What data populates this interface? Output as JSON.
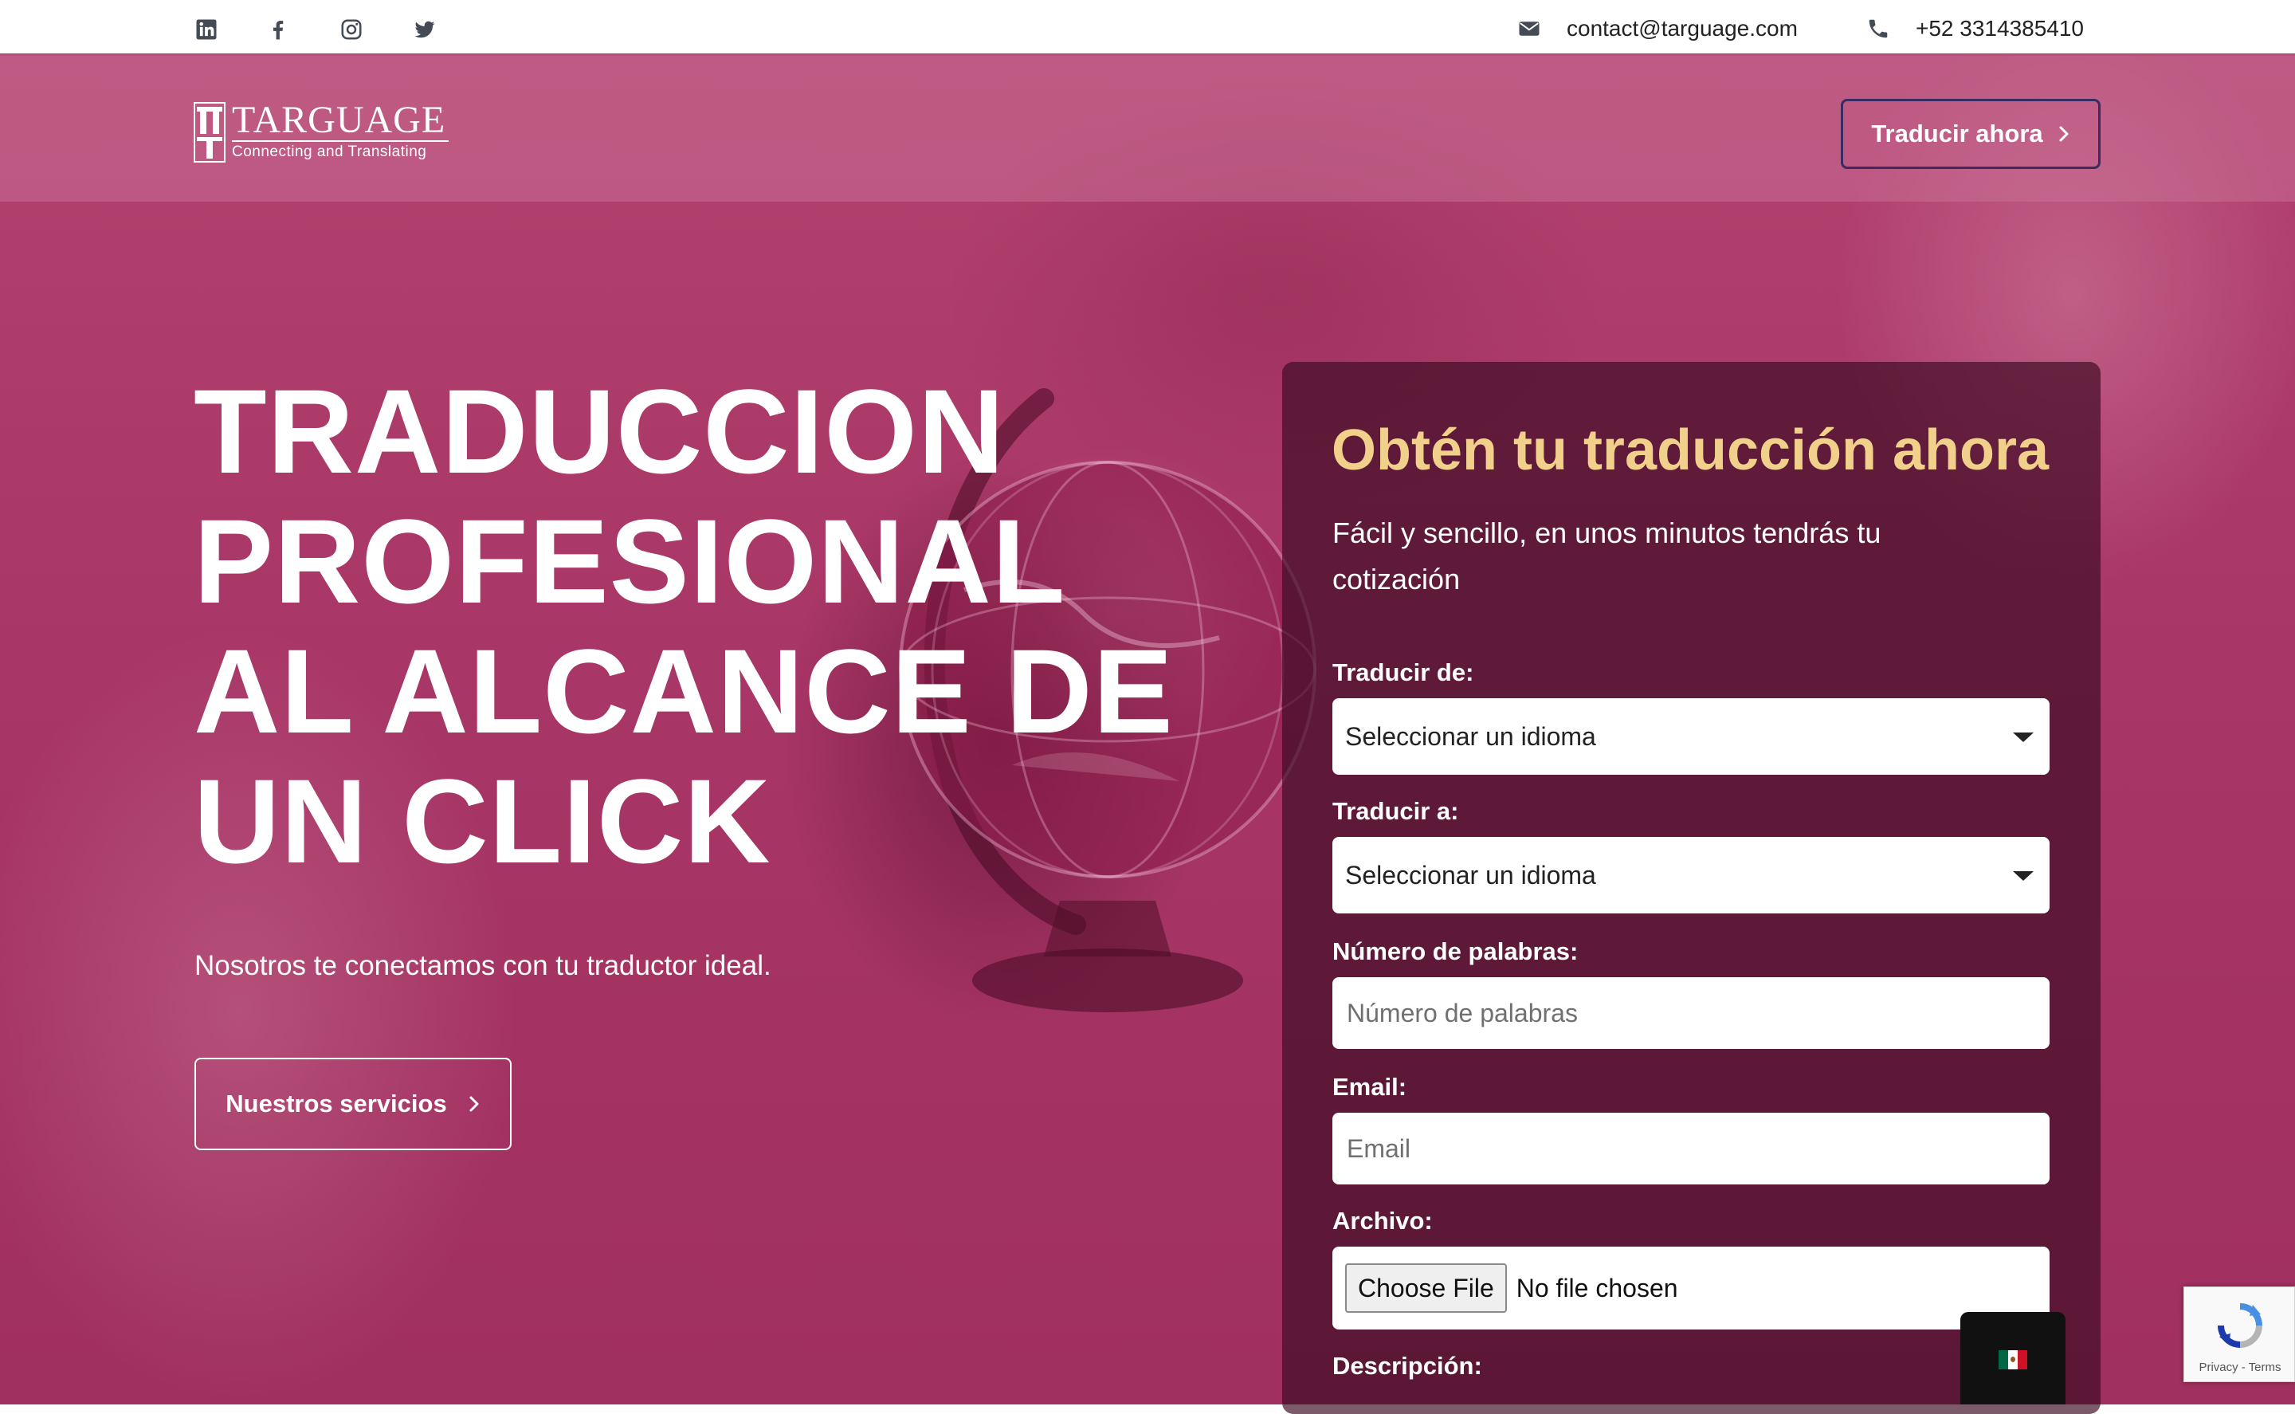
{
  "topbar": {
    "social_icons": [
      "linkedin-icon",
      "facebook-icon",
      "instagram-icon",
      "twitter-icon"
    ],
    "email": "contact@targuage.com",
    "phone": "+52 3314385410"
  },
  "header": {
    "logo_name": "TARGUAGE",
    "logo_tagline": "Connecting and Translating",
    "cta_label": "Traducir ahora"
  },
  "hero": {
    "title": "TRADUCCION PROFESIONAL AL ALCANCE DE UN CLICK",
    "subtitle": "Nosotros te conectamos con tu traductor ideal.",
    "cta_label": "Nuestros servicios"
  },
  "form": {
    "title": "Obtén tu traducción ahora",
    "subtitle": "Fácil y sencillo, en unos minutos tendrás tu cotización",
    "from_label": "Traducir de:",
    "from_value": "Seleccionar un idioma",
    "to_label": "Traducir a:",
    "to_value": "Seleccionar un idioma",
    "words_label": "Número de palabras:",
    "words_placeholder": "Número de palabras",
    "email_label": "Email:",
    "email_placeholder": "Email",
    "file_label": "Archivo:",
    "file_button": "Choose File",
    "file_status": "No file chosen",
    "description_label": "Descripción:"
  },
  "widgets": {
    "language_flag": "mexico-flag",
    "recaptcha_text": "Privacy - Terms"
  },
  "colors": {
    "brand_pink": "#a83666",
    "card_title": "#f0d08a",
    "cta_border": "#3a2c62",
    "topbar_border": "#b44f78"
  }
}
